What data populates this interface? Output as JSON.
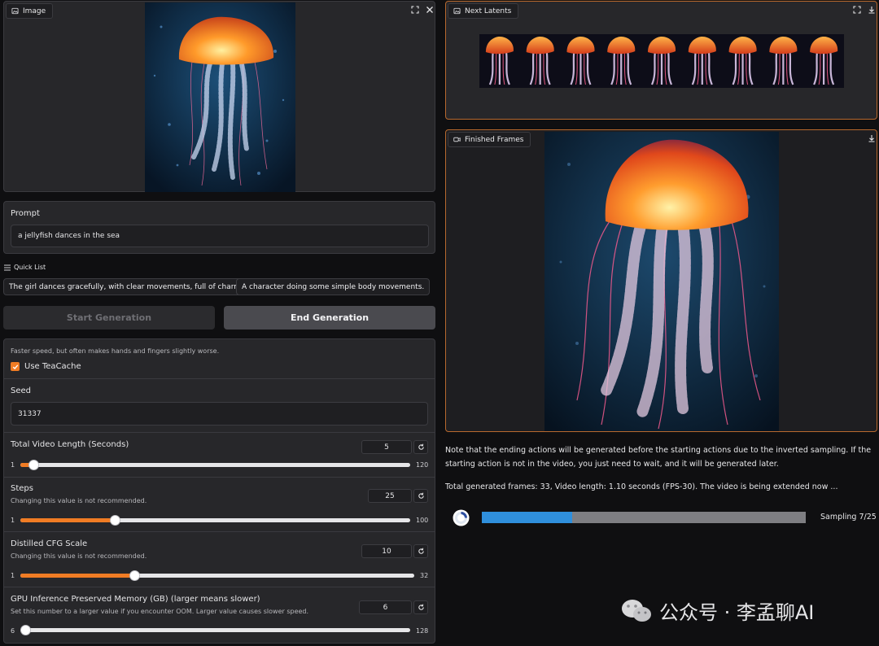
{
  "image_panel": {
    "label": "Image",
    "icon": "image-icon",
    "actions": [
      "fullscreen-icon",
      "close-icon"
    ]
  },
  "prompt": {
    "label": "Prompt",
    "value": "a jellyfish dances in the sea"
  },
  "quick_list": {
    "label": "Quick List",
    "items": [
      "The girl dances gracefully, with clear movements, full of charm.",
      "A character doing some simple body movements."
    ]
  },
  "buttons": {
    "start": "Start Generation",
    "end": "End Generation"
  },
  "teacache": {
    "hint": "Faster speed, but often makes hands and fingers slightly worse.",
    "label": "Use TeaCache",
    "checked": true
  },
  "seed": {
    "label": "Seed",
    "value": "31337"
  },
  "sliders": [
    {
      "label": "Total Video Length (Seconds)",
      "info": "",
      "value": "5",
      "min": "1",
      "max": "120",
      "fraction": 0.034
    },
    {
      "label": "Steps",
      "info": "Changing this value is not recommended.",
      "value": "25",
      "min": "1",
      "max": "100",
      "fraction": 0.242
    },
    {
      "label": "Distilled CFG Scale",
      "info": "Changing this value is not recommended.",
      "value": "10",
      "min": "1",
      "max": "32",
      "fraction": 0.29
    },
    {
      "label": "GPU Inference Preserved Memory (GB) (larger means slower)",
      "info": "Set this number to a larger value if you encounter OOM. Larger value causes slower speed.",
      "value": "6",
      "min": "6",
      "max": "128",
      "fraction": 0.0
    }
  ],
  "next_latents": {
    "label": "Next Latents",
    "icon": "image-icon",
    "frame_count": 9
  },
  "finished_frames": {
    "label": "Finished Frames",
    "icon": "video-icon"
  },
  "note": "Note that the ending actions will be generated before the starting actions due to the inverted sampling. If the starting action is not in the video, you just need to wait, and it will be generated later.",
  "status": "Total generated frames: 33, Video length: 1.10 seconds (FPS-30). The video is being extended now ...",
  "progress": {
    "label": "Sampling 7/25",
    "fraction": 0.28
  },
  "colors": {
    "accent": "#f07c24",
    "progress": "#2f8fdc",
    "panel": "#27272a",
    "background": "#0f0f11"
  },
  "watermark": {
    "text": "公众号 · 李孟聊AI",
    "icon": "wechat-icon"
  }
}
